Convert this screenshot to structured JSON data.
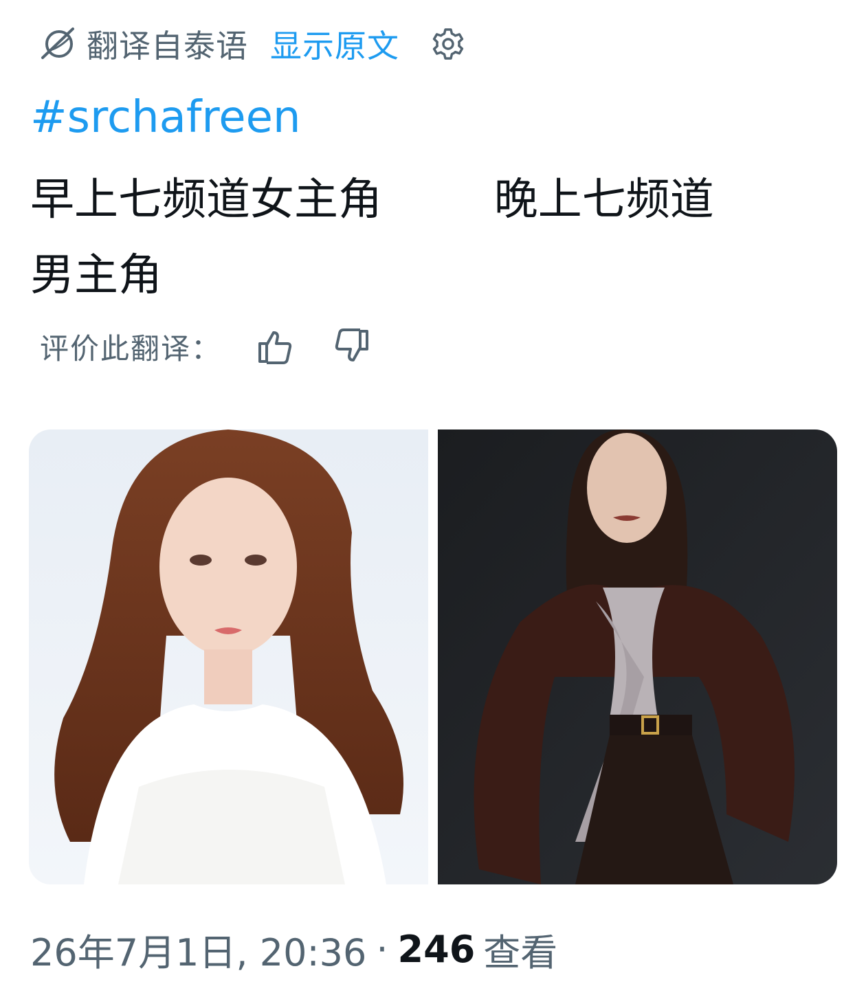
{
  "translation_bar": {
    "translated_from": "翻译自泰语",
    "show_original": "显示原文"
  },
  "tweet": {
    "hashtag": "#srchafreen",
    "text": "早上七频道女主角        晚上七频道\n男主角"
  },
  "rating": {
    "label": "评价此翻译："
  },
  "media": {
    "images": [
      {
        "icon": "photo-woman-light-background"
      },
      {
        "icon": "photo-woman-dark-background"
      }
    ]
  },
  "meta": {
    "timestamp": "26年7月1日, 20:36",
    "separator": "·",
    "views_count": "246",
    "views_label": "查看"
  },
  "colors": {
    "accent": "#1d9bf0",
    "secondary_text": "#536471",
    "primary_text": "#0f1419"
  }
}
